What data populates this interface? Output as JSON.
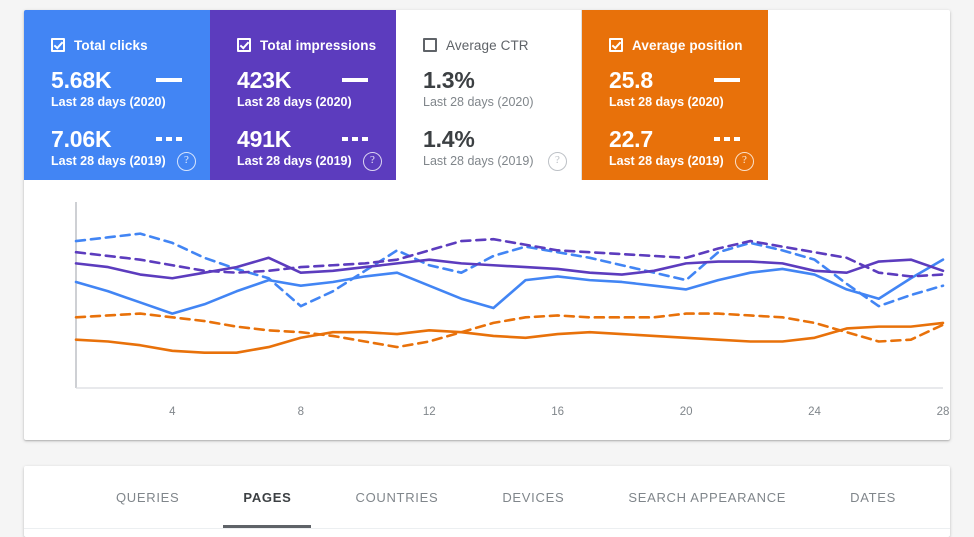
{
  "cards": [
    {
      "id": "total-clicks",
      "label": "Total clicks",
      "checked": true,
      "color": "#4285f4",
      "current": {
        "value": "5.68K",
        "period": "Last 28 days (2020)",
        "style": "solid"
      },
      "previous": {
        "value": "7.06K",
        "period": "Last 28 days (2019)",
        "style": "dotted"
      },
      "help": "?"
    },
    {
      "id": "total-impressions",
      "label": "Total impressions",
      "checked": true,
      "color": "#5c3cbe",
      "current": {
        "value": "423K",
        "period": "Last 28 days (2020)",
        "style": "solid"
      },
      "previous": {
        "value": "491K",
        "period": "Last 28 days (2019)",
        "style": "dotted"
      },
      "help": "?"
    },
    {
      "id": "average-ctr",
      "label": "Average CTR",
      "checked": false,
      "color": "#ffffff",
      "current": {
        "value": "1.3%",
        "period": "Last 28 days (2020)",
        "style": "none"
      },
      "previous": {
        "value": "1.4%",
        "period": "Last 28 days (2019)",
        "style": "none"
      },
      "help": "?"
    },
    {
      "id": "average-position",
      "label": "Average position",
      "checked": true,
      "color": "#e8710a",
      "current": {
        "value": "25.8",
        "period": "Last 28 days (2020)",
        "style": "solid"
      },
      "previous": {
        "value": "22.7",
        "period": "Last 28 days (2019)",
        "style": "dotted"
      },
      "help": "?"
    }
  ],
  "tabs": [
    {
      "id": "queries",
      "label": "QUERIES",
      "active": false
    },
    {
      "id": "pages",
      "label": "PAGES",
      "active": true
    },
    {
      "id": "countries",
      "label": "COUNTRIES",
      "active": false
    },
    {
      "id": "devices",
      "label": "DEVICES",
      "active": false
    },
    {
      "id": "search-appearance",
      "label": "SEARCH APPEARANCE",
      "active": false
    },
    {
      "id": "dates",
      "label": "DATES",
      "active": false
    }
  ],
  "chart_data": {
    "type": "line",
    "title": "",
    "xlabel": "",
    "ylabel": "",
    "grid": false,
    "legend_position": "cards-above",
    "x": [
      1,
      2,
      3,
      4,
      5,
      6,
      7,
      8,
      9,
      10,
      11,
      12,
      13,
      14,
      15,
      16,
      17,
      18,
      19,
      20,
      21,
      22,
      23,
      24,
      25,
      26,
      27,
      28
    ],
    "xticks": [
      4,
      8,
      12,
      16,
      20,
      24,
      28
    ],
    "xticklabels": [
      "4",
      "8",
      "12",
      "16",
      "20",
      "24",
      "28"
    ],
    "ylim": [
      0,
      100
    ],
    "series": [
      {
        "name": "Total clicks — Last 28 days (2020)",
        "color": "#4285f4",
        "style": "solid",
        "values": [
          57,
          52,
          46,
          40,
          45,
          52,
          58,
          55,
          57,
          60,
          62,
          55,
          48,
          43,
          58,
          60,
          58,
          57,
          55,
          53,
          58,
          62,
          64,
          61,
          53,
          48,
          59,
          69
        ]
      },
      {
        "name": "Total clicks — Last 28 days (2019)",
        "color": "#4285f4",
        "style": "dashed",
        "values": [
          79,
          81,
          83,
          78,
          70,
          64,
          59,
          44,
          52,
          63,
          74,
          66,
          62,
          71,
          76,
          73,
          70,
          66,
          62,
          58,
          73,
          78,
          74,
          69,
          56,
          44,
          50,
          55
        ]
      },
      {
        "name": "Total impressions — Last 28 days (2020)",
        "color": "#5c3cbe",
        "style": "solid",
        "values": [
          67,
          65,
          61,
          59,
          62,
          65,
          70,
          62,
          63,
          65,
          67,
          69,
          67,
          66,
          65,
          64,
          62,
          61,
          63,
          67,
          68,
          68,
          67,
          63,
          62,
          68,
          69,
          63
        ]
      },
      {
        "name": "Total impressions — Last 28 days (2019)",
        "color": "#5c3cbe",
        "style": "dashed",
        "values": [
          73,
          71,
          69,
          66,
          63,
          62,
          63,
          65,
          66,
          67,
          69,
          74,
          79,
          80,
          77,
          74,
          73,
          72,
          71,
          70,
          75,
          79,
          76,
          73,
          70,
          62,
          60,
          61
        ]
      },
      {
        "name": "Average position — Last 28 days (2020)",
        "color": "#e8710a",
        "style": "solid",
        "values": [
          26,
          25,
          23,
          20,
          19,
          19,
          22,
          27,
          30,
          30,
          29,
          31,
          30,
          28,
          27,
          29,
          30,
          29,
          28,
          27,
          26,
          25,
          25,
          27,
          32,
          33,
          33,
          35
        ]
      },
      {
        "name": "Average position — Last 28 days (2019)",
        "color": "#e8710a",
        "style": "dashed",
        "values": [
          38,
          39,
          40,
          38,
          36,
          33,
          31,
          30,
          28,
          25,
          22,
          25,
          30,
          35,
          38,
          39,
          38,
          38,
          38,
          40,
          40,
          39,
          38,
          35,
          30,
          25,
          26,
          34
        ]
      }
    ]
  }
}
